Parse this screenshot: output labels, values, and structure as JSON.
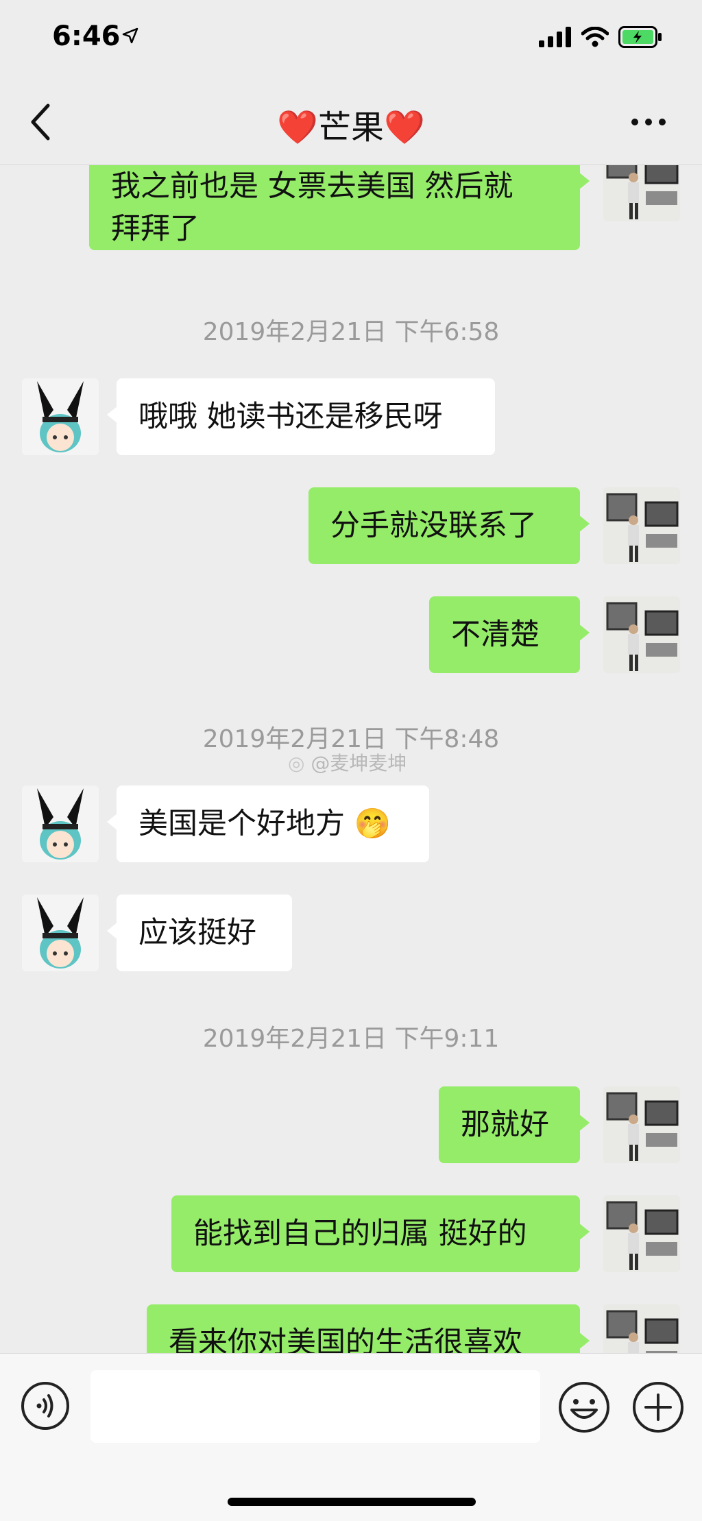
{
  "status_bar": {
    "time": "6:46"
  },
  "header": {
    "title": "❤️芒果❤️",
    "back_icon": "chevron-left-icon",
    "more_icon": "more-dots-icon"
  },
  "messages": [
    {
      "side": "out",
      "lines": [
        "我之前也是  女票去美国 然后就",
        "拜拜了"
      ]
    },
    {
      "type": "time",
      "text": "2019年2月21日 下午6:58"
    },
    {
      "side": "in",
      "text": "哦哦 她读书还是移民呀"
    },
    {
      "side": "out",
      "text": "分手就没联系了"
    },
    {
      "side": "out",
      "text": "不清楚"
    },
    {
      "type": "time",
      "text": "2019年2月21日 下午8:48"
    },
    {
      "side": "in",
      "text": "美国是个好地方",
      "emoji": "🤭"
    },
    {
      "side": "in",
      "text": "应该挺好"
    },
    {
      "type": "time",
      "text": "2019年2月21日 下午9:11"
    },
    {
      "side": "out",
      "text": "那就好"
    },
    {
      "side": "out",
      "text": "能找到自己的归属 挺好的"
    },
    {
      "side": "out",
      "text": "看来你对美国的生活很喜欢"
    }
  ],
  "watermark": "@麦坤麦坤",
  "input_bar": {
    "voice_icon": "voice-icon",
    "emoji_icon": "emoji-icon",
    "plus_icon": "plus-icon",
    "input_value": ""
  },
  "colors": {
    "outgoing_bubble": "#95ec69",
    "incoming_bubble": "#ffffff",
    "background": "#ededed"
  }
}
